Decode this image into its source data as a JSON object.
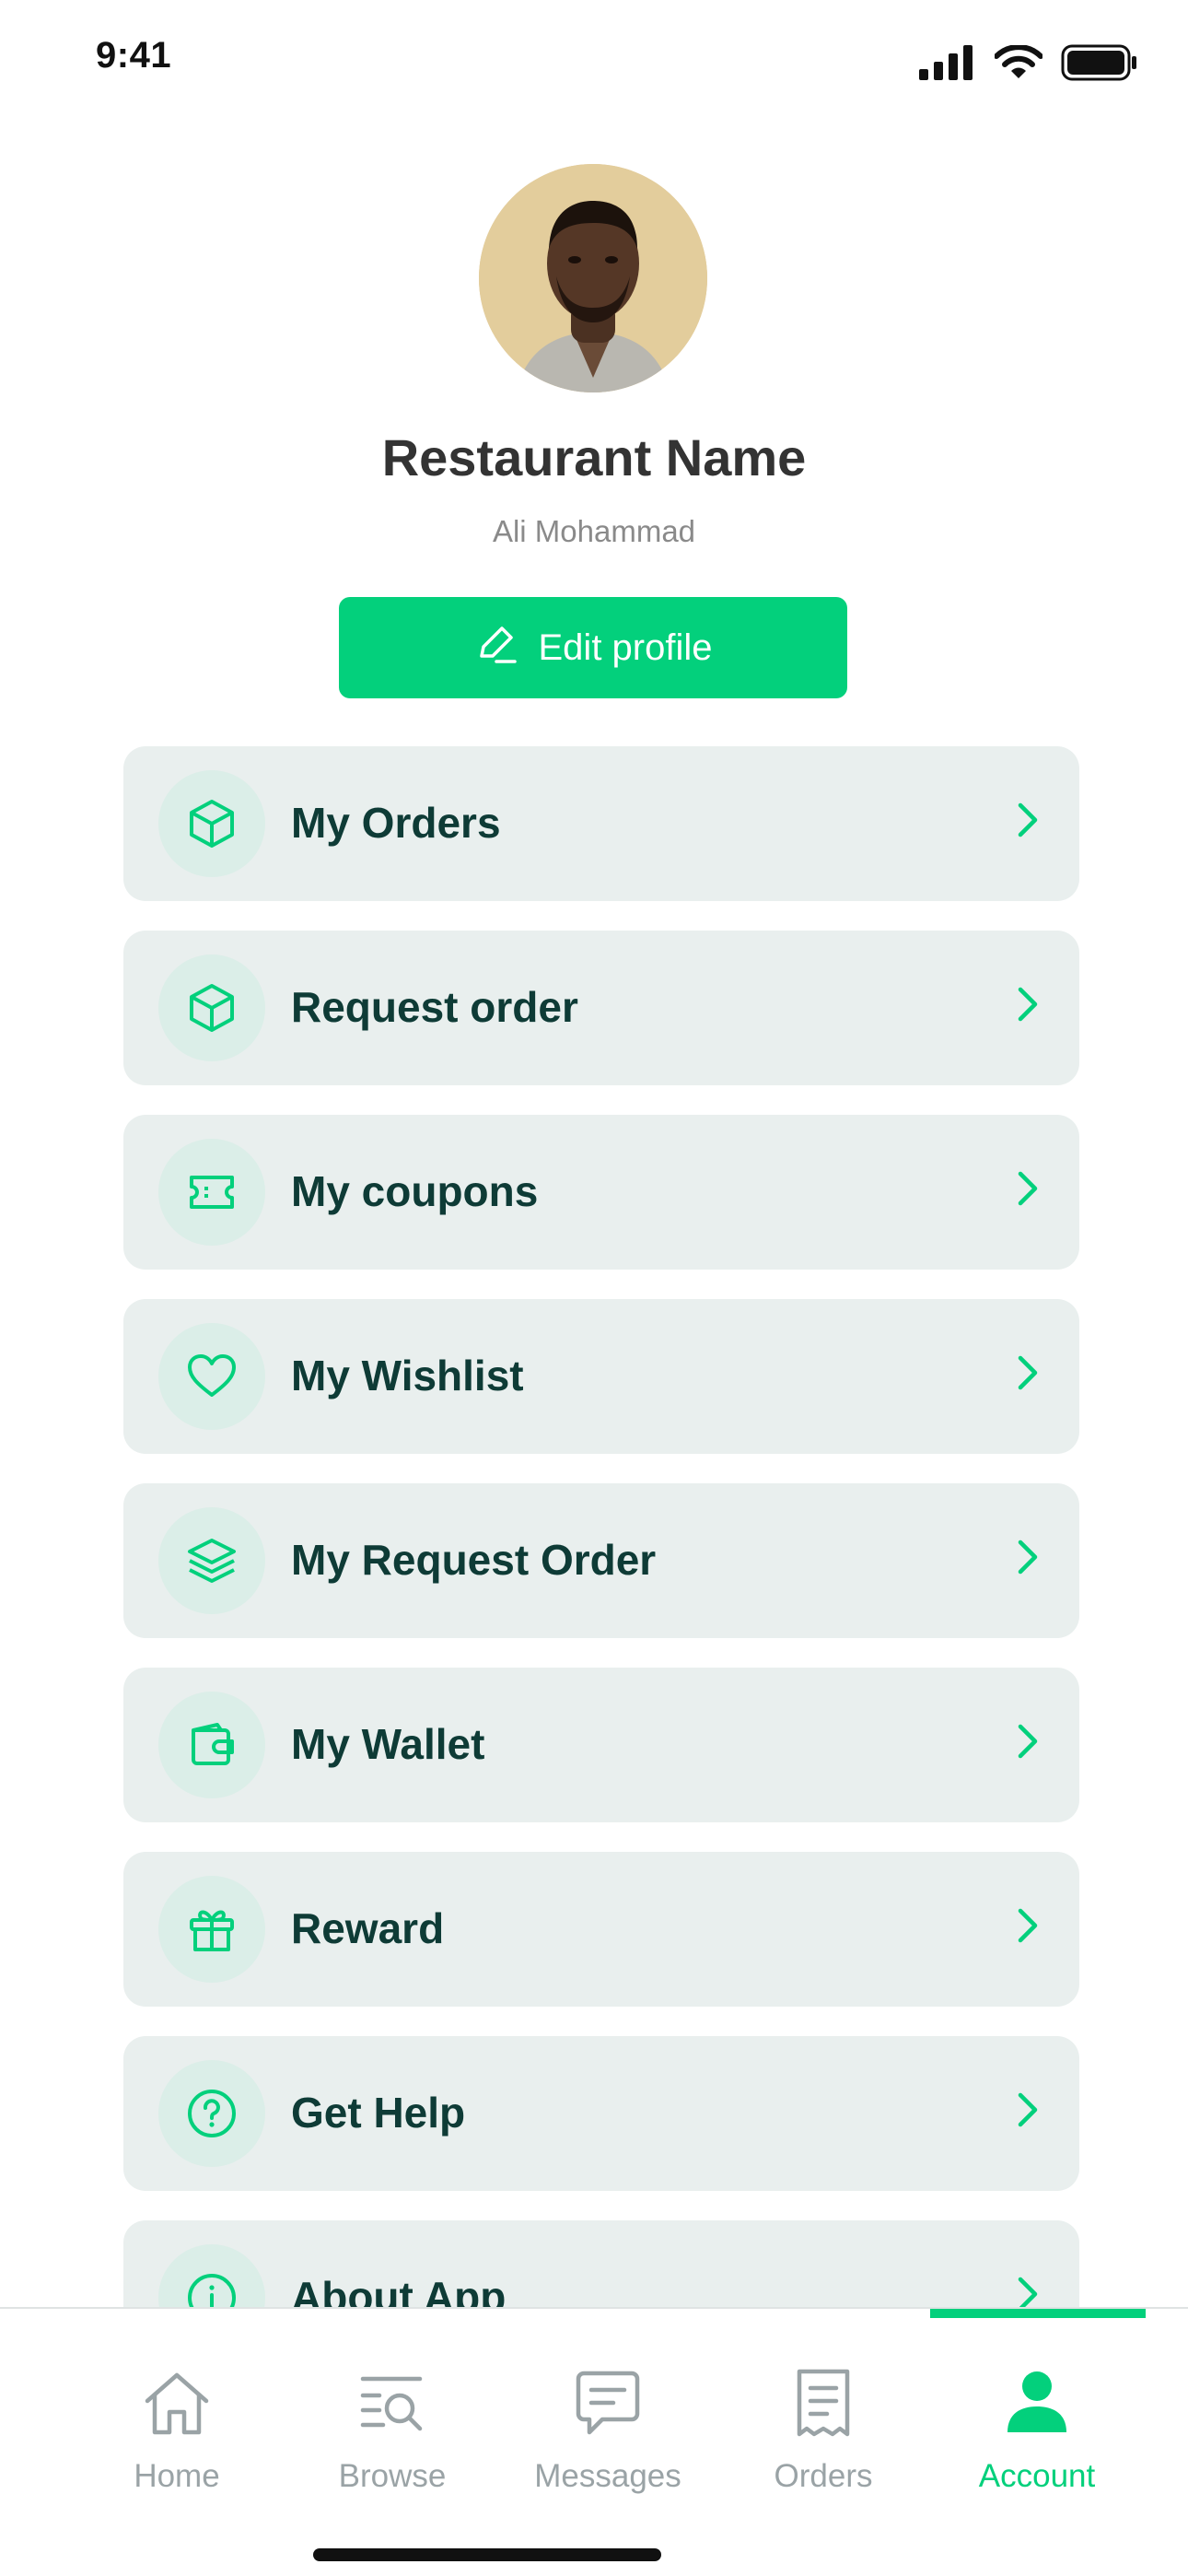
{
  "status_bar": {
    "time": "9:41"
  },
  "profile": {
    "restaurant_name": "Restaurant Name",
    "owner_name": "Ali Mohammad",
    "edit_label": "Edit profile"
  },
  "menu": {
    "items": [
      {
        "label": "My Orders",
        "icon": "box-icon"
      },
      {
        "label": "Request order",
        "icon": "box-icon"
      },
      {
        "label": "My coupons",
        "icon": "ticket-icon"
      },
      {
        "label": "My Wishlist",
        "icon": "heart-icon"
      },
      {
        "label": "My Request Order",
        "icon": "layers-icon"
      },
      {
        "label": "My Wallet",
        "icon": "wallet-icon"
      },
      {
        "label": "Reward",
        "icon": "gift-icon"
      },
      {
        "label": "Get Help",
        "icon": "help-circle-icon"
      },
      {
        "label": "About App",
        "icon": "info-icon"
      }
    ]
  },
  "bottom_nav": {
    "items": [
      {
        "label": "Home",
        "icon": "home-icon",
        "active": false
      },
      {
        "label": "Browse",
        "icon": "browse-icon",
        "active": false
      },
      {
        "label": "Messages",
        "icon": "message-icon",
        "active": false
      },
      {
        "label": "Orders",
        "icon": "receipt-icon",
        "active": false
      },
      {
        "label": "Account",
        "icon": "user-icon",
        "active": true
      }
    ]
  },
  "colors": {
    "accent": "#03d07c",
    "card_bg": "#e9efee",
    "text_dark": "#0e3b36",
    "inactive": "#9aa3a6"
  }
}
